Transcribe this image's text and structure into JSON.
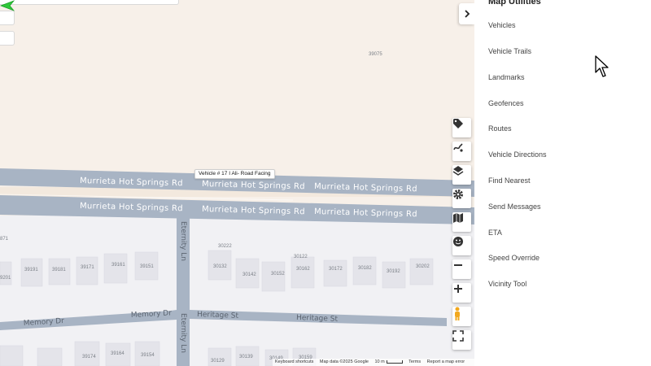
{
  "map": {
    "roads": {
      "murrieta_label": "Murrieta Hot Springs Rd",
      "eternity_label": "Eternity Ln",
      "memory_label": "Memory Dr",
      "heritage_label": "Heritage St"
    },
    "addresses": {
      "top_parcel": "39075",
      "left_edge": "871",
      "row1": [
        "39191",
        "39181",
        "39171",
        "39161",
        "39151",
        "30222",
        "30132",
        "30142",
        "30152",
        "30122",
        "30162",
        "30172",
        "30182",
        "30192",
        "30202"
      ],
      "left_row": "9201",
      "row2": [
        "39174",
        "39164",
        "39154",
        "30129",
        "30139",
        "30149",
        "30159"
      ]
    },
    "vehicle_tooltip": "Vehicle # 17 I Ali- Road Facing",
    "attribution": {
      "shortcuts": "Keyboard shortcuts",
      "data": "Map data ©2025 Google",
      "scale": "10 m",
      "terms": "Terms",
      "report": "Report a map error"
    },
    "controls": [
      "tag-icon",
      "route-draw-icon",
      "layers-icon",
      "gear-icon",
      "map-icon",
      "smiley-icon",
      "zoom-out-icon",
      "zoom-in-icon",
      "pegman-icon",
      "fullscreen-icon"
    ]
  },
  "panel": {
    "title": "Map Utilities",
    "items": [
      "Vehicles",
      "Vehicle Trails",
      "Landmarks",
      "Geofences",
      "Routes",
      "Vehicle Directions",
      "Find Nearest",
      "Send Messages",
      "ETA",
      "Speed Override",
      "Vicinity Tool"
    ]
  },
  "colors": {
    "map_background": "#f7f0e9",
    "road": "#a8b4c4",
    "residential": "#f1f1f4",
    "vehicle_marker": "#2fc83a"
  }
}
